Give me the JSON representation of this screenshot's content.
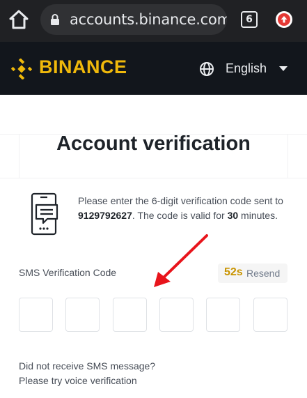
{
  "browser": {
    "url": "accounts.binance.com/e",
    "tab_count": "6",
    "icons": [
      "home-icon",
      "lock-icon",
      "update-icon"
    ]
  },
  "header": {
    "logo_text": "BINANCE",
    "language": "English",
    "brand_color": "#f0b90b",
    "icons": [
      "binance-logo-icon",
      "globe-icon",
      "caret-down-icon"
    ]
  },
  "verification": {
    "title": "Account verification",
    "info_prefix": "Please enter the 6-digit verification code sent to ",
    "phone": "9129792627",
    "info_middle": ". The code is valid for ",
    "valid_minutes": "30",
    "info_suffix": " minutes.",
    "code_label": "SMS Verification Code",
    "resend_countdown": "52s",
    "resend_label": "Resend",
    "code_digits": [
      "",
      "",
      "",
      "",
      "",
      ""
    ],
    "help_line_1": "Did not receive SMS message?",
    "help_line_2": "Please try voice verification"
  },
  "annotation": {
    "arrow_color": "#e8141b"
  }
}
